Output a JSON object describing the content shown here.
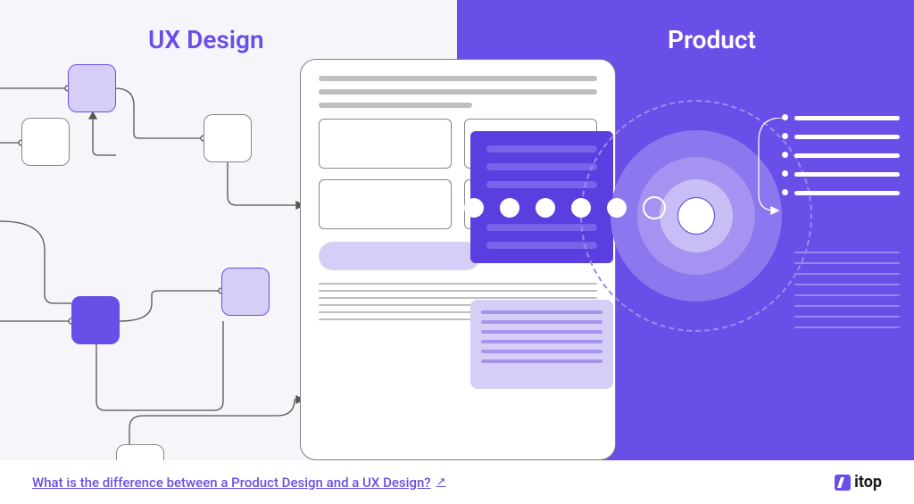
{
  "heading_left": "UX Design",
  "heading_right": "Product",
  "footer": {
    "link_text": "What is the difference between a Product Design and a UX Design?",
    "link_icon": "↗"
  },
  "brand": {
    "name": "itop"
  },
  "colors": {
    "accent": "#6a4ee8",
    "accent_light": "#d6cef6",
    "accent_mid": "#8d77ee",
    "bg_left": "#f5f5fa"
  },
  "left_flow": {
    "nodes": [
      {
        "id": "nb1",
        "state": "highlighted"
      },
      {
        "id": "nb2",
        "state": "default"
      },
      {
        "id": "nb3",
        "state": "default"
      },
      {
        "id": "nb4",
        "state": "highlighted"
      },
      {
        "id": "nb5",
        "state": "filled"
      },
      {
        "id": "nb6",
        "state": "default"
      }
    ]
  },
  "center_wireframe": {
    "top_lines": 3,
    "grid_rows": 2,
    "has_pill": true,
    "bottom_thin_lines": 6
  },
  "radar": {
    "rings": 5
  },
  "dot_count": 6,
  "right_lines": {
    "bold": 5,
    "thin": 8
  }
}
